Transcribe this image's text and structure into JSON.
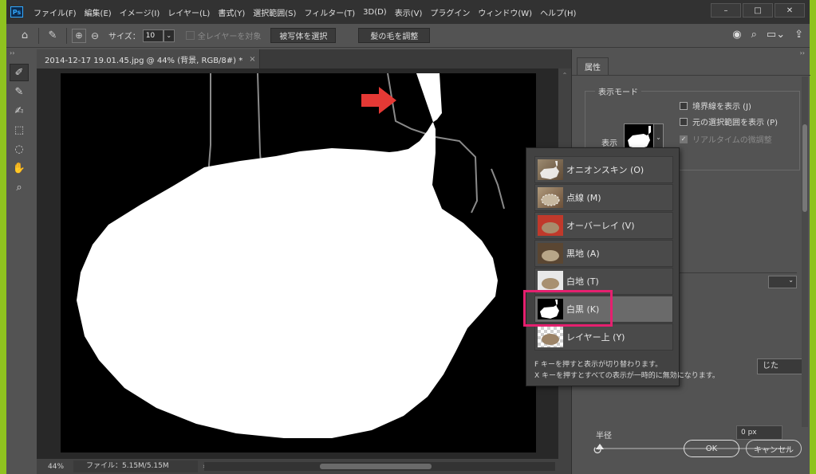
{
  "app": {
    "logo": "Ps",
    "menu": [
      "ファイル(F)",
      "編集(E)",
      "イメージ(I)",
      "レイヤー(L)",
      "書式(Y)",
      "選択範囲(S)",
      "フィルター(T)",
      "3D(D)",
      "表示(V)",
      "プラグイン",
      "ウィンドウ(W)",
      "ヘルプ(H)"
    ],
    "window_controls": [
      "–",
      "□",
      "✕"
    ]
  },
  "options_bar": {
    "size_label": "サイズ：",
    "size_value": "10",
    "all_layers_label": "全レイヤーを対象",
    "select_subject_label": "被写体を選択",
    "refine_hair_label": "髪の毛を調整"
  },
  "document": {
    "tab_title": "2014-12-17 19.01.45.jpg @ 44% (背景, RGB/8#) *",
    "tab_close": "×",
    "zoom": "44%",
    "file_info": "ファイル：5.15M/5.15M"
  },
  "properties_panel": {
    "tab_label": "属性",
    "view_mode_group": "表示モード",
    "view_label": "表示",
    "checkboxes": [
      {
        "label": "境界線を表示 (J)",
        "checked": false,
        "disabled": false
      },
      {
        "label": "元の選択範囲を表示 (P)",
        "checked": false,
        "disabled": false
      },
      {
        "label": "リアルタイムの微調整",
        "checked": true,
        "disabled": true
      }
    ],
    "partial_button_label": "じた",
    "radius_label": "半径",
    "radius_value": "0 px",
    "ok_label": "OK",
    "cancel_label": "キャンセル"
  },
  "view_mode_popup": {
    "items": [
      {
        "label": "オニオンスキン (O)",
        "thumb": "onion"
      },
      {
        "label": "点線 (M)",
        "thumb": "photo"
      },
      {
        "label": "オーバーレイ (V)",
        "thumb": "overlay"
      },
      {
        "label": "黒地 (A)",
        "thumb": "dark"
      },
      {
        "label": "白地 (T)",
        "thumb": "light"
      },
      {
        "label": "白黒 (K)",
        "thumb": "bw"
      },
      {
        "label": "レイヤー上 (Y)",
        "thumb": "checker"
      }
    ],
    "selected_index": 5,
    "hint_line1": "F キーを押すと表示が切り替わります。",
    "hint_line2": "X キーを押すとすべての表示が一時的に無効になります。"
  },
  "colors": {
    "accent_highlight": "#e5206f",
    "arrow": "#e53935",
    "desktop_bg": "#8fc31f"
  }
}
